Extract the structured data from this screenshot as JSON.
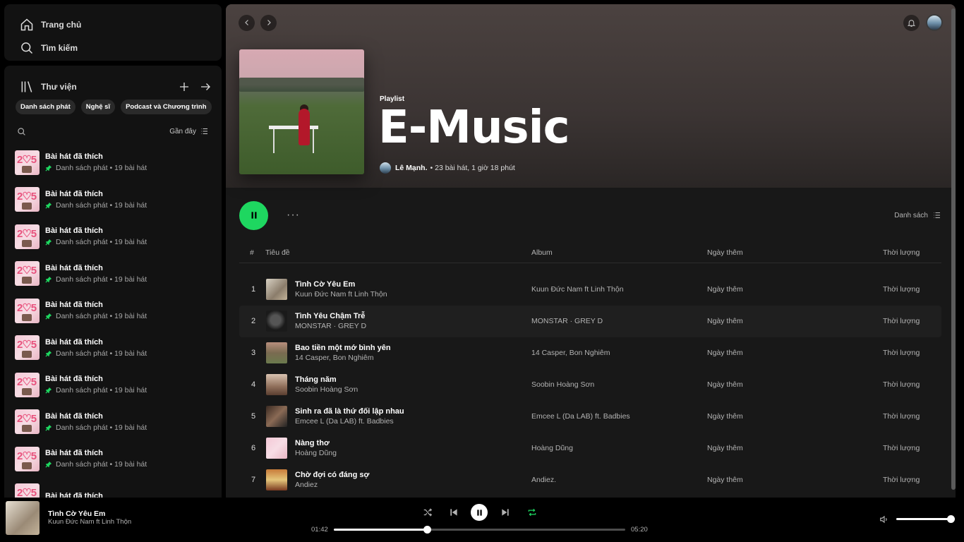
{
  "nav": {
    "home": "Trang chủ",
    "search": "Tìm kiếm"
  },
  "library": {
    "title": "Thư viện",
    "chips": [
      "Danh sách phát",
      "Nghệ sĩ",
      "Podcast và Chương trình"
    ],
    "sort_label": "Gần đây",
    "items": [
      {
        "name": "Bài hát đã thích",
        "sub": "Danh sách phát • 19 bài hát"
      },
      {
        "name": "Bài hát đã thích",
        "sub": "Danh sách phát • 19 bài hát"
      },
      {
        "name": "Bài hát đã thích",
        "sub": "Danh sách phát • 19 bài hát"
      },
      {
        "name": "Bài hát đã thích",
        "sub": "Danh sách phát • 19 bài hát"
      },
      {
        "name": "Bài hát đã thích",
        "sub": "Danh sách phát • 19 bài hát"
      },
      {
        "name": "Bài hát đã thích",
        "sub": "Danh sách phát • 19 bài hát"
      },
      {
        "name": "Bài hát đã thích",
        "sub": "Danh sách phát • 19 bài hát"
      },
      {
        "name": "Bài hát đã thích",
        "sub": "Danh sách phát • 19 bài hát"
      },
      {
        "name": "Bài hát đã thích",
        "sub": "Danh sách phát • 19 bài hát"
      },
      {
        "name": "Bài hát đã thích",
        "sub": ""
      }
    ]
  },
  "playlist": {
    "type": "Playlist",
    "title": "E-Music",
    "owner": "Lê Mạnh.",
    "info": "• 23 bài hát, 1 giờ 18 phút",
    "view_label": "Danh sách"
  },
  "table": {
    "headers": {
      "num": "#",
      "title": "Tiêu đề",
      "album": "Album",
      "date": "Ngày thêm",
      "duration": "Thời lượng"
    },
    "rows": [
      {
        "n": "1",
        "title": "Tình Cờ Yêu Em",
        "artist": "Kuun Đức Nam ft Linh Thộn",
        "album": "Kuun Đức Nam ft Linh Thộn",
        "date": "Ngày thêm",
        "dur": "Thời lượng"
      },
      {
        "n": "2",
        "title": "Tình Yêu Chậm Trễ",
        "artist": "MONSTAR · GREY D",
        "album": "MONSTAR · GREY D",
        "date": "Ngày thêm",
        "dur": "Thời lượng"
      },
      {
        "n": "3",
        "title": "Bao tiền một mớ bình yên",
        "artist": "14 Casper, Bon Nghiêm",
        "album": "14 Casper, Bon Nghiêm",
        "date": "Ngày thêm",
        "dur": "Thời lượng"
      },
      {
        "n": "4",
        "title": "Tháng năm",
        "artist": "Soobin Hoàng Sơn",
        "album": "Soobin Hoàng Sơn",
        "date": "Ngày thêm",
        "dur": "Thời lượng"
      },
      {
        "n": "5",
        "title": "Sinh ra đã là thứ đối lập nhau",
        "artist": "Emcee L (Da LAB) ft. Badbies",
        "album": "Emcee L (Da LAB) ft. Badbies",
        "date": "Ngày thêm",
        "dur": "Thời lượng"
      },
      {
        "n": "6",
        "title": "Nàng thơ",
        "artist": "Hoàng Dũng",
        "album": "Hoàng Dũng",
        "date": "Ngày thêm",
        "dur": "Thời lượng"
      },
      {
        "n": "7",
        "title": "Chờ đợi có đáng sợ",
        "artist": "Andiez",
        "album": "Andiez.",
        "date": "Ngày thêm",
        "dur": "Thời lượng"
      }
    ]
  },
  "player": {
    "track": "Tình Cờ Yêu Em",
    "artist": "Kuun Đức Nam ft Linh Thộn",
    "elapsed": "01:42",
    "total": "05:20",
    "progress": 0.32,
    "volume": 1.0
  },
  "colors": {
    "accent": "#1ed760",
    "bg": "#121212"
  }
}
